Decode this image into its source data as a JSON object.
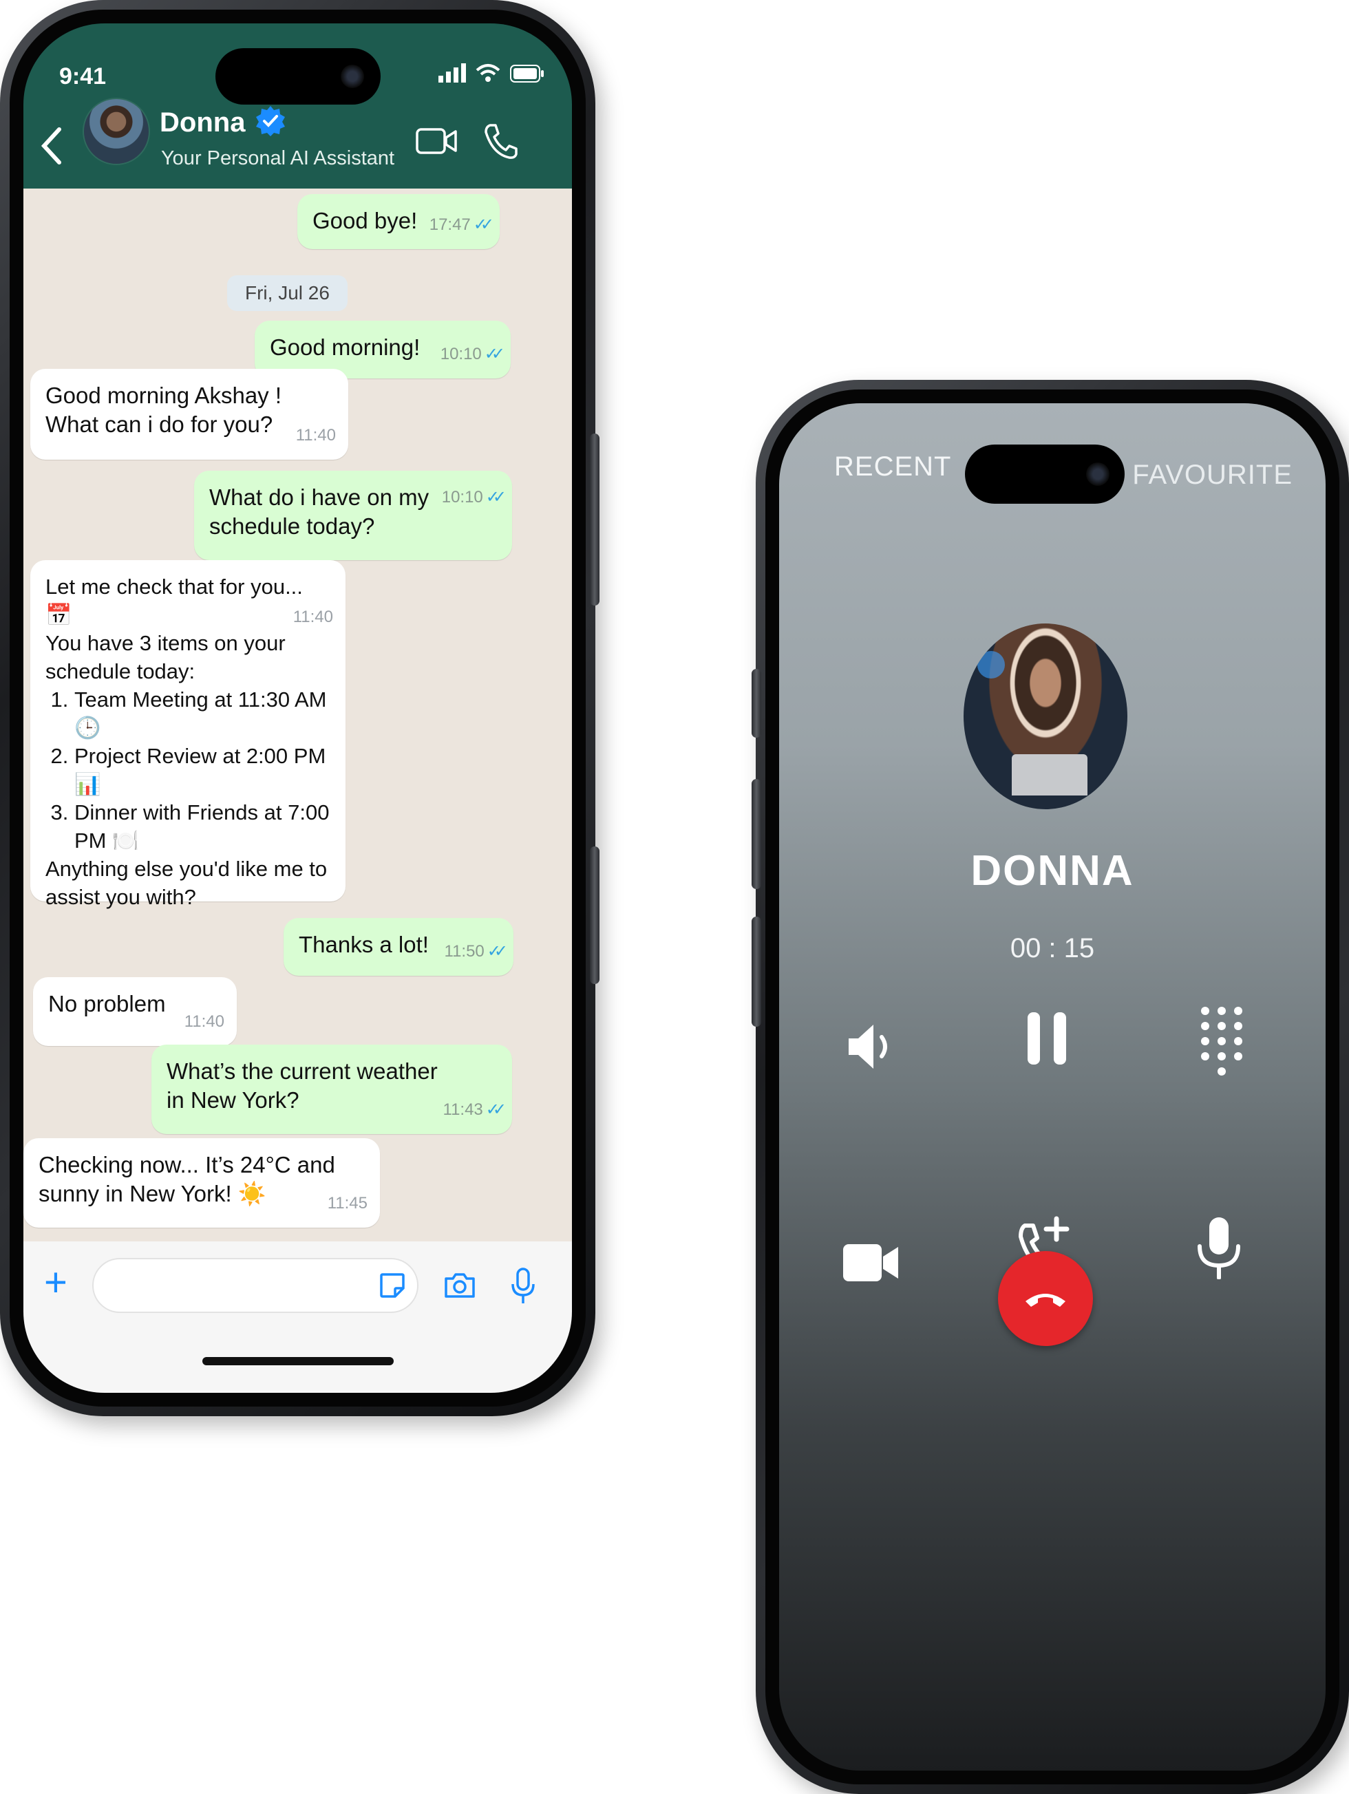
{
  "chat": {
    "status_time": "9:41",
    "contact_name": "Donna",
    "contact_subtitle": "Your Personal AI Assistant",
    "date_chip": "Fri, Jul 26",
    "messages": [
      {
        "text": "Good bye!",
        "time": "17:47"
      },
      {
        "text": "Good morning!",
        "time": "10:10"
      },
      {
        "line1": "Good morning Akshay !",
        "line2": "What can i do for you?",
        "time": "11:40"
      },
      {
        "line1": "What do i have on my",
        "line2": "schedule today?",
        "time": "10:10"
      },
      {
        "intro1": "Let me check that for you... 📅",
        "intro2": "You have 3 items on your",
        "intro3": "schedule today:",
        "items": [
          "Team Meeting at 11:30 AM 🕒",
          "Project Review at 2:00 PM 📊",
          "Dinner with Friends at 7:00 PM 🍽️"
        ],
        "outro": "Anything else you'd like me to assist you with?",
        "time": "11:40"
      },
      {
        "text": "Thanks a lot!",
        "time": "11:50"
      },
      {
        "text": "No problem",
        "time": "11:40"
      },
      {
        "line1": "What’s the current weather",
        "line2": "in New York?",
        "time": "11:43"
      },
      {
        "line1": "Checking now... It’s 24°C and",
        "line2": "sunny in New York! ☀️",
        "time": "11:45"
      }
    ],
    "colors": {
      "header": "#1d5b4f",
      "outgoing": "#d9fdd3",
      "incoming": "#ffffff",
      "read_tick": "#34a3e0"
    }
  },
  "call": {
    "tab_recent": "RECENT",
    "tab_favourite": "FAVOURITE",
    "caller_name": "DONNA",
    "timer": "00 : 15",
    "end_color": "#e5262b"
  }
}
